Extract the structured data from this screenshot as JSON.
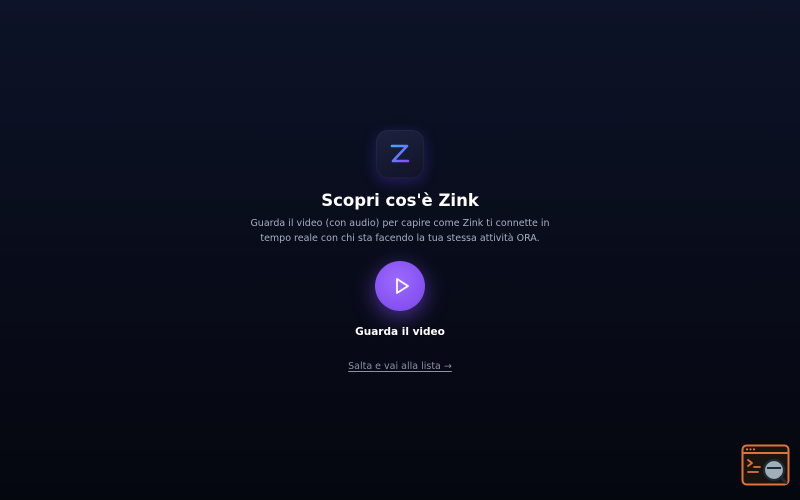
{
  "logo": {
    "icon": "zink-z-logo-icon",
    "gradient_start": "#3fa9ff",
    "gradient_end": "#8a4dff"
  },
  "intro": {
    "title": "Scopri cos'è Zink",
    "description_line1": "Guarda il video (con audio) per capire come Zink ti connette in",
    "description_line2": "tempo reale con chi sta facendo la tua stessa attività ORA."
  },
  "video": {
    "play_icon": "play-icon",
    "label": "Guarda il video",
    "accent": "#8a55f5"
  },
  "skip": {
    "label": "Salta e vai alla lista →"
  },
  "widget": {
    "icon": "inspect-console-icon",
    "accent": "#e0733a"
  }
}
